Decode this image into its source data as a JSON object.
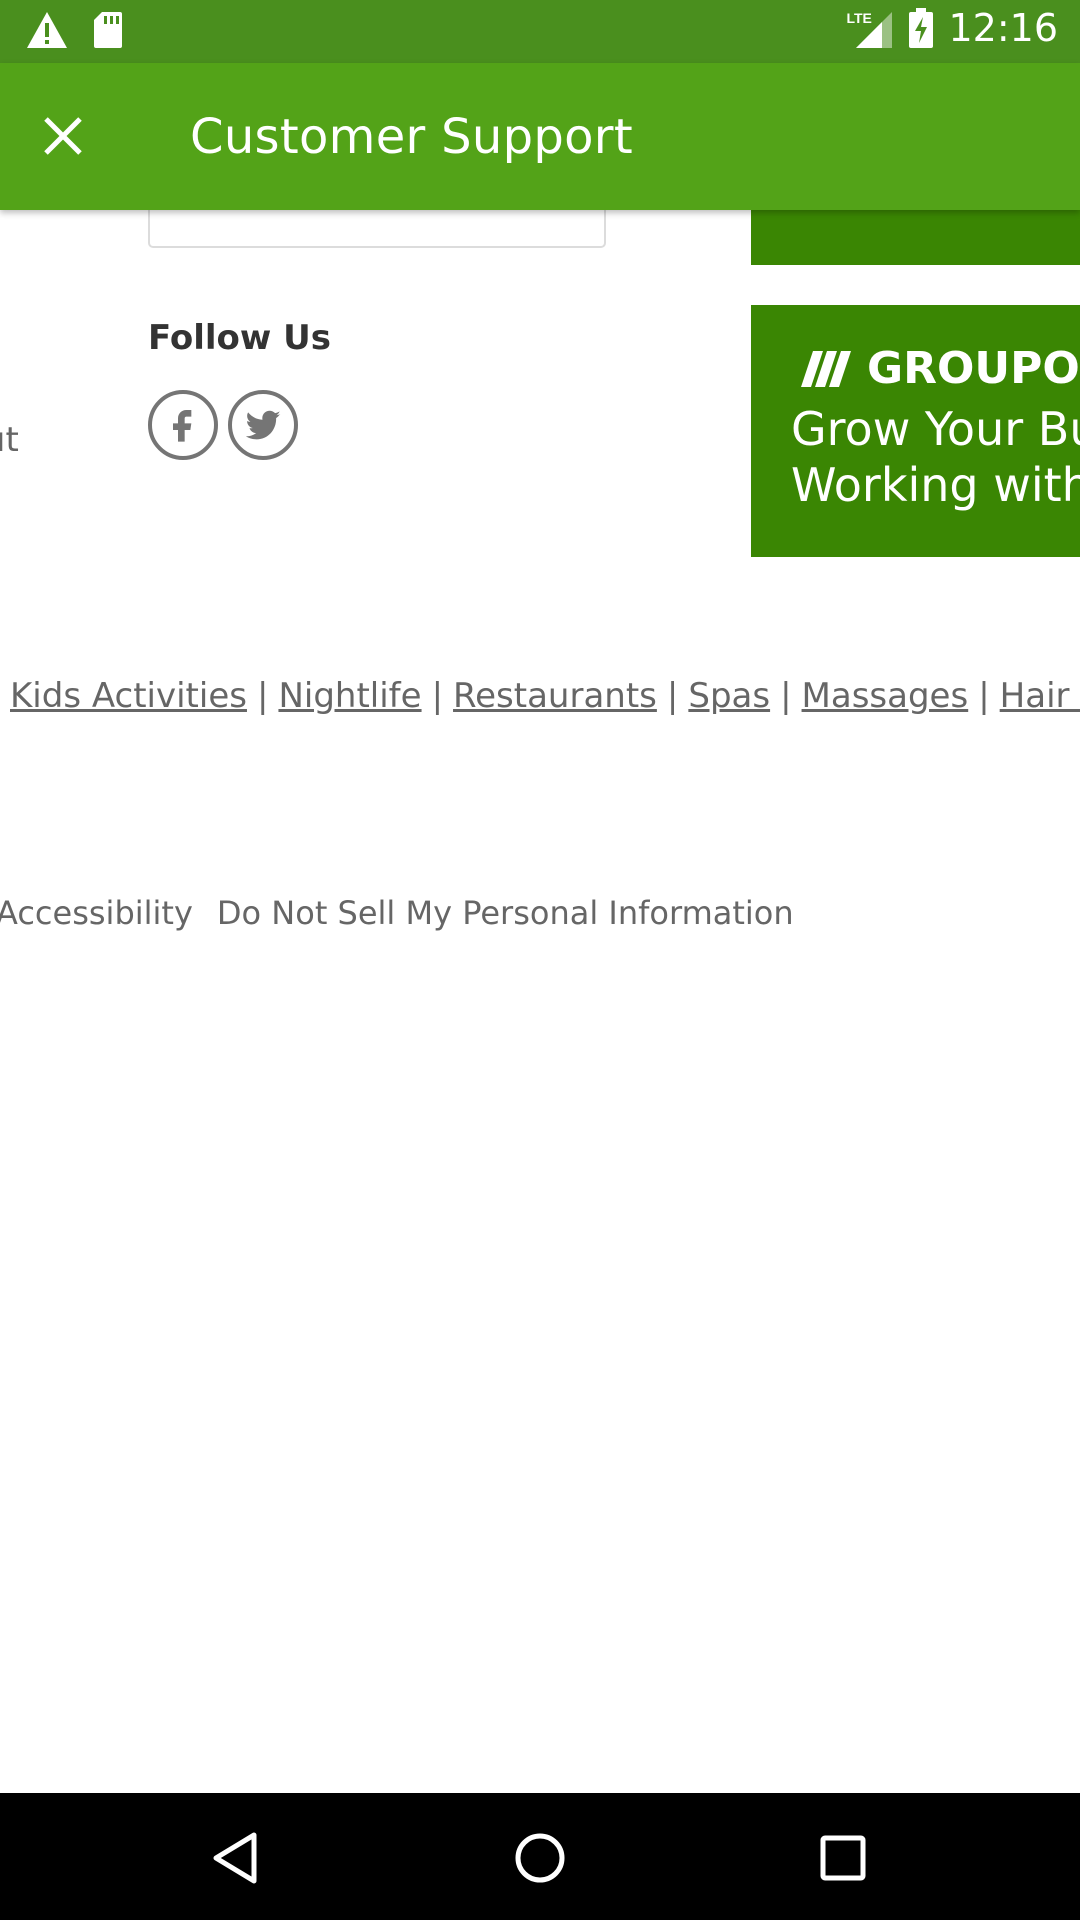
{
  "status_bar": {
    "time": "12:16",
    "network_label": "LTE",
    "icons": [
      "warning-icon",
      "sd-card-icon",
      "signal-icon",
      "battery-charging-icon"
    ]
  },
  "app_bar": {
    "title": "Customer Support",
    "close_icon": "close-icon"
  },
  "page": {
    "cut_text": "ıt",
    "follow_us": {
      "title": "Follow Us",
      "icons": [
        "facebook-icon",
        "twitter-icon"
      ]
    },
    "promo": {
      "logo_text": "GROUPON",
      "line1": "Grow Your Bu",
      "line2": "Working with"
    },
    "links": [
      {
        "label": "Kids Activities"
      },
      {
        "label": "Nightlife"
      },
      {
        "label": "Restaurants"
      },
      {
        "label": "Spas"
      },
      {
        "label": "Massages"
      },
      {
        "label": "Hair Salons"
      }
    ],
    "legal_links": [
      "Accessibility",
      "Do Not Sell My Personal Information"
    ]
  },
  "nav_bar": {
    "icons": [
      "back-icon",
      "home-icon",
      "recents-icon"
    ]
  },
  "colors": {
    "status_bar": "#4a8f1e",
    "app_bar": "#53a318",
    "promo": "#3a8603",
    "text_gray": "#666666"
  }
}
